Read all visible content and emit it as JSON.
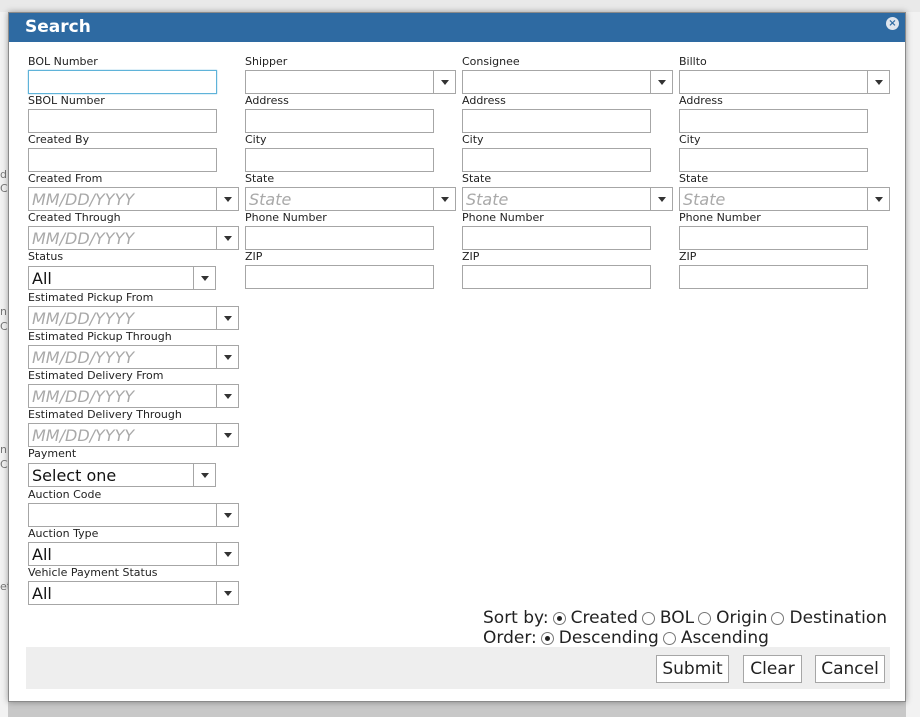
{
  "dialog": {
    "title": "Search",
    "close_symbol": "×"
  },
  "left": {
    "bol_number": "BOL Number",
    "sbol_number": "SBOL Number",
    "created_by": "Created By",
    "created_from": "Created From",
    "created_through": "Created Through",
    "status": "Status",
    "status_value": "All",
    "est_pickup_from": "Estimated Pickup From",
    "est_pickup_through": "Estimated Pickup Through",
    "est_delivery_from": "Estimated Delivery From",
    "est_delivery_through": "Estimated Delivery Through",
    "payment": "Payment",
    "payment_value": "Select one",
    "auction_code": "Auction Code",
    "auction_type": "Auction Type",
    "auction_type_value": "All",
    "vehicle_payment_status": "Vehicle Payment Status",
    "vehicle_payment_status_value": "All",
    "date_placeholder": "MM/DD/YYYY"
  },
  "parties": [
    {
      "heading": "Shipper",
      "address": "Address",
      "city": "City",
      "state": "State",
      "state_placeholder": "State",
      "phone": "Phone Number",
      "zip": "ZIP"
    },
    {
      "heading": "Consignee",
      "address": "Address",
      "city": "City",
      "state": "State",
      "state_placeholder": "State",
      "phone": "Phone Number",
      "zip": "ZIP"
    },
    {
      "heading": "Billto",
      "address": "Address",
      "city": "City",
      "state": "State",
      "state_placeholder": "State",
      "phone": "Phone Number",
      "zip": "ZIP"
    }
  ],
  "sort": {
    "label": "Sort by:",
    "options": [
      "Created",
      "BOL",
      "Origin",
      "Destination"
    ],
    "selected": "Created"
  },
  "order": {
    "label": "Order:",
    "options": [
      "Descending",
      "Ascending"
    ],
    "selected": "Descending"
  },
  "buttons": {
    "submit": "Submit",
    "clear": "Clear",
    "cancel": "Cancel"
  },
  "background": {
    "glyphs": [
      "d",
      "C",
      "n",
      "C",
      "n",
      "C",
      "et"
    ]
  }
}
